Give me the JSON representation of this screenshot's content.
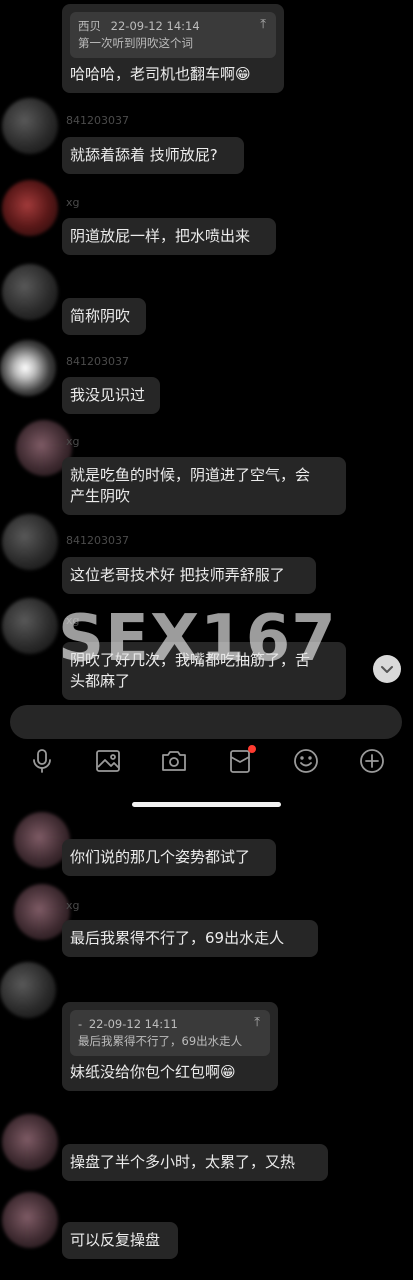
{
  "messages_top": [
    {
      "quote_sender": "西贝",
      "quote_time": "22-09-12 14:14",
      "quote_text": "第一次听到阴吹这个词",
      "text": "哈哈哈，老司机也翻车啊😁"
    },
    {
      "sender": "841203037",
      "text": "就舔着舔着 技师放屁?"
    },
    {
      "sender": "xg",
      "text": "阴道放屁一样，把水喷出来"
    },
    {
      "sender": "",
      "text": "简称阴吹"
    },
    {
      "sender": "841203037",
      "text": "我没见识过"
    },
    {
      "sender": "xg",
      "text_line1": "就是吃鱼的时候，阴道进了空气，会",
      "text_line2": "产生阴吹"
    },
    {
      "sender": "841203037",
      "text": "这位老哥技术好 把技师弄舒服了"
    },
    {
      "sender": "xg",
      "text_line1": "阴吹了好几次，我嘴都吃抽筋了，舌",
      "text_line2": "头都麻了"
    }
  ],
  "watermark": "SEX167",
  "toolbar": {
    "icons": [
      "microphone-icon",
      "image-icon",
      "camera-icon",
      "red-packet-icon",
      "emoji-icon",
      "plus-icon"
    ],
    "notification_color": "#ff3b30"
  },
  "messages_bottom": [
    {
      "sender": "",
      "text": "你们说的那几个姿势都试了"
    },
    {
      "sender": "xg",
      "text": "最后我累得不行了，69出水走人"
    },
    {
      "quote_sender": "-",
      "quote_time": "22-09-12 14:11",
      "quote_text": "最后我累得不行了，69出水走人",
      "text": "妹纸没给你包个红包啊😁"
    },
    {
      "sender": "",
      "text": "操盘了半个多小时，太累了，又热"
    },
    {
      "sender": "",
      "text": "可以反复操盘"
    }
  ],
  "colors": {
    "bubble": "#262626",
    "quote": "#3a3a3a",
    "background": "#000000"
  }
}
